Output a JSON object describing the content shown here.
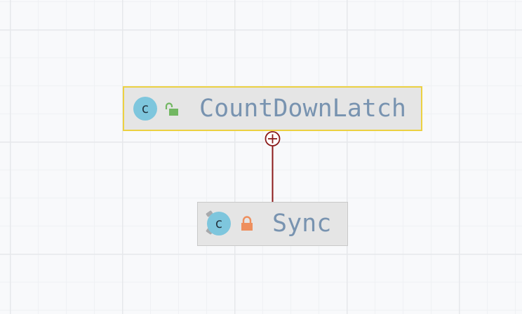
{
  "diagram": {
    "nodes": [
      {
        "name": "CountDownLatch",
        "kind": "class",
        "class_badge": "c",
        "access_icon": "unlocked-padlock-icon",
        "access_color": "#72b762",
        "selected": true,
        "highlight_color": "#ecd142"
      },
      {
        "name": "Sync",
        "kind": "abstract-class",
        "class_badge": "c",
        "access_icon": "locked-padlock-icon",
        "access_color": "#ee8f5e",
        "selected": false
      }
    ],
    "edges": [
      {
        "from": "Sync",
        "to": "CountDownLatch",
        "relation": "inner-class",
        "marker_icon": "circle-plus-icon",
        "color": "#8b1a1a"
      }
    ]
  }
}
